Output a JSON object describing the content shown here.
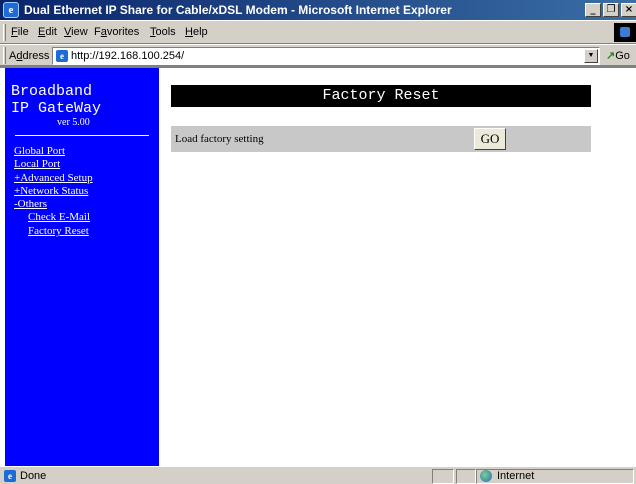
{
  "window": {
    "title": "Dual Ethernet IP Share for Cable/xDSL Modem - Microsoft Internet Explorer",
    "minimize_glyph": "_",
    "restore_glyph": "❐",
    "close_glyph": "×"
  },
  "menu": [
    {
      "accel": "F",
      "rest": "ile"
    },
    {
      "accel": "E",
      "rest": "dit"
    },
    {
      "accel": "V",
      "rest": "iew"
    },
    {
      "pre": "F",
      "accel": "a",
      "rest": "vorites"
    },
    {
      "accel": "T",
      "rest": "ools"
    },
    {
      "accel": "H",
      "rest": "elp"
    }
  ],
  "address": {
    "label_pre": "A",
    "label_accel": "d",
    "label_rest": "dress",
    "url": "http://192.168.100.254/",
    "go_label": "Go"
  },
  "sidebar": {
    "brand_line1": "Broadband",
    "brand_line2": "IP GateWay",
    "version": "ver 5.00",
    "nav": [
      {
        "label": "Global Port",
        "sub": false
      },
      {
        "label": "Local Port",
        "sub": false
      },
      {
        "label": "+Advanced Setup",
        "sub": false
      },
      {
        "label": "+Network Status",
        "sub": false
      },
      {
        "label": "-Others",
        "sub": false
      },
      {
        "label": "Check E-Mail",
        "sub": true
      },
      {
        "label": "Factory Reset",
        "sub": true
      }
    ]
  },
  "main": {
    "title": "Factory Reset",
    "row_label": "Load factory setting",
    "button_label": "GO"
  },
  "status": {
    "text": "Done",
    "zone": "Internet"
  },
  "icons": {
    "title": "ie-logo-icon",
    "address": "page-icon",
    "status": "page-icon",
    "zone": "globe-icon"
  },
  "colors": {
    "sidebar": "#0000ff",
    "title_bar_start": "#0a246a",
    "title_bar_end": "#3a6ea5",
    "panel_title_bg": "#000000",
    "panel_row_bg": "#c8c8c8"
  }
}
